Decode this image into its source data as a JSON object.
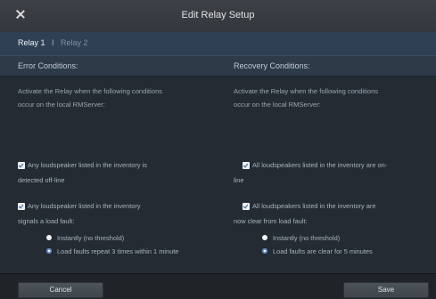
{
  "dialog": {
    "title": "Edit Relay Setup"
  },
  "tabs": [
    {
      "label": "Relay 1"
    },
    {
      "label": "I"
    },
    {
      "label": "Relay 2"
    }
  ],
  "error": {
    "heading": "Error Conditions:",
    "intro_line1": "Activate the Relay when the following conditions",
    "intro_line2": "occur on the local RMServer:",
    "offline_line1": "Any loudspeaker listed in the inventory is",
    "offline_line2": "detected off-line",
    "fault_line1": "Any loudspeaker listed in the inventory",
    "fault_line2": "signals a load fault:",
    "option_instant": "Instantly (no threshold)",
    "option_threshold": "Load faults repeat 3 times within 1 minute"
  },
  "recovery": {
    "heading": "Recovery Conditions:",
    "intro_line1": "Activate the Relay when the following conditions",
    "intro_line2": "occur on the local RMServer:",
    "online_line1": "All loudspeakers listed in the inventory are on-",
    "online_line2": "line",
    "clear_line1": "All loudspeakers listed in the inventory are",
    "clear_line2": "now clear from load fault:",
    "option_instant": "Instantly (no threshold)",
    "option_threshold": "Load faults are clear for 5 minutes"
  },
  "footer": {
    "cancel_label": "Cancel",
    "save_label": "Save"
  }
}
